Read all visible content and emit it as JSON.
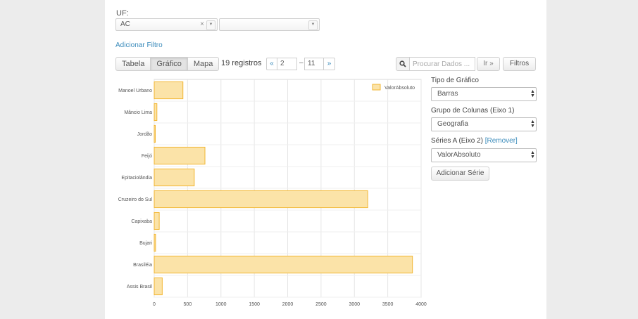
{
  "filters": {
    "uf_label": "UF:",
    "uf_value": "AC",
    "uf_clear": "×",
    "second_value": "",
    "add_filter": "Adicionar Filtro"
  },
  "view_tabs": [
    {
      "label": "Tabela",
      "active": false
    },
    {
      "label": "Gráfico",
      "active": true
    },
    {
      "label": "Mapa",
      "active": false
    }
  ],
  "records": "19 registros",
  "pager": {
    "prev": "«",
    "from": "2",
    "dash": "–",
    "to": "11",
    "next": "»"
  },
  "search": {
    "placeholder": "Procurar Dados ...",
    "go": "Ir »",
    "filters": "Filtros"
  },
  "side": {
    "chart_type_label": "Tipo de Gráfico",
    "chart_type_value": "Barras",
    "group_label": "Grupo de Colunas (Eixo 1)",
    "group_value": "Geografia",
    "series_label": "Séries A (Eixo 2)",
    "remover": "[Remover]",
    "series_value": "ValorAbsoluto",
    "add_series": "Adicionar Série"
  },
  "colors": {
    "bar_fill": "#fbe3a8",
    "bar_stroke": "#f2b632",
    "link": "#3a8bbb"
  },
  "chart_data": {
    "type": "bar",
    "orientation": "horizontal",
    "categories": [
      "Manoel Urbano",
      "Mâncio Lima",
      "Jordão",
      "Feijó",
      "Epitaciolândia",
      "Cruzeiro do Sul",
      "Capixaba",
      "Bujari",
      "Brasiléia",
      "Assis Brasil"
    ],
    "series": [
      {
        "name": "ValorAbsoluto",
        "values": [
          430,
          40,
          15,
          760,
          600,
          3200,
          75,
          20,
          3870,
          120
        ]
      }
    ],
    "x_ticks": [
      "0",
      "500",
      "1000",
      "1500",
      "2000",
      "2500",
      "3000",
      "3500",
      "4000"
    ],
    "xlim": [
      0,
      4000
    ],
    "grid": true,
    "legend_position": "top-right"
  }
}
